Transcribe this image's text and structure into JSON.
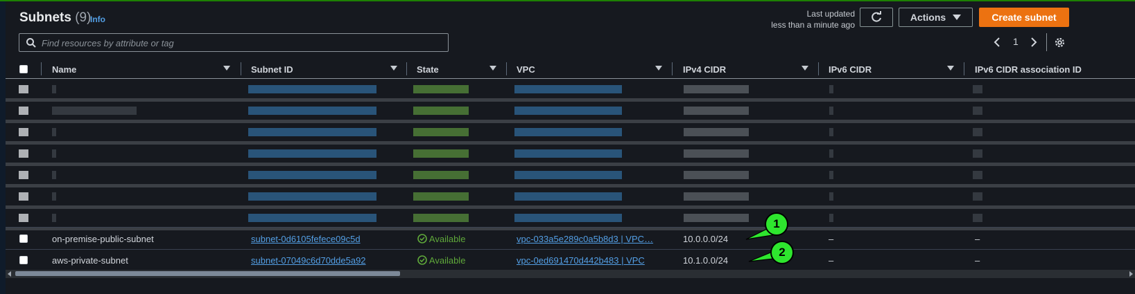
{
  "header": {
    "title": "Subnets",
    "count": "(9)",
    "info_link": "Info",
    "last_updated_line1": "Last updated",
    "last_updated_line2": "less than a minute ago",
    "actions_label": "Actions",
    "create_label": "Create subnet"
  },
  "search": {
    "placeholder": "Find resources by attribute or tag"
  },
  "pagination": {
    "current_page": "1"
  },
  "columns": [
    "Name",
    "Subnet ID",
    "State",
    "VPC",
    "IPv4 CIDR",
    "IPv6 CIDR",
    "IPv6 CIDR association ID"
  ],
  "rows": [
    {
      "name": "on-premise-public-subnet",
      "subnet_id": "subnet-0d6105fefece09c5d",
      "state": "Available",
      "vpc": "vpc-033a5e289c0a5b8d3 | VPC…",
      "ipv4": "10.0.0.0/24",
      "ipv6": "–",
      "ipv6_assoc": "–"
    },
    {
      "name": "aws-private-subnet",
      "subnet_id": "subnet-07049c6d70dde5a92",
      "state": "Available",
      "vpc": "vpc-0ed691470d442b483 | VPC",
      "ipv4": "10.1.0.0/24",
      "ipv6": "–",
      "ipv6_assoc": "–"
    }
  ],
  "annotations": [
    "1",
    "2"
  ],
  "colors": {
    "accent_orange": "#ec7211",
    "link_blue": "#539fe5",
    "available_green": "#5fa83a",
    "callout_green": "#2ee62e"
  }
}
